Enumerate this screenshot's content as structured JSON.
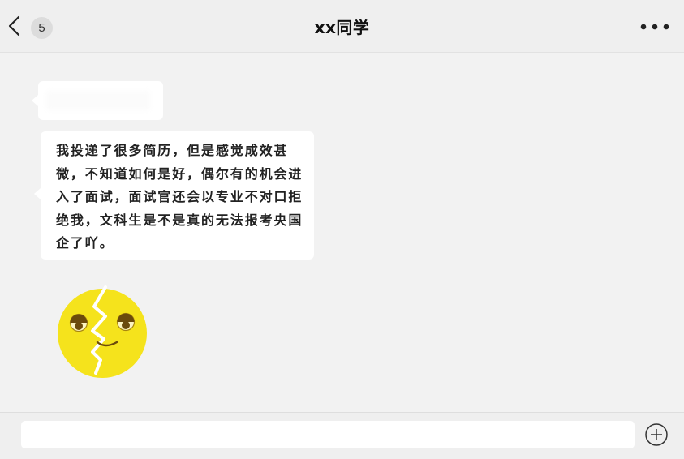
{
  "header": {
    "unread_count": "5",
    "title": "xx同学",
    "back_icon": "chevron-left-icon",
    "more_icon": "more-dots-icon"
  },
  "messages": [
    {
      "type": "text",
      "content": "我投递了很多简历，但是感觉成效甚微，不知道如何是好，偶尔有的机会进入了面试，面试官还会以专业不对口拒绝我，文科生是不是真的无法报考央国企了吖。"
    },
    {
      "type": "sticker",
      "sticker_name": "broken-face-sticker"
    }
  ],
  "input": {
    "value": "",
    "plus_icon": "plus-circle-icon"
  },
  "colors": {
    "background": "#f2f2f2",
    "bubble": "#ffffff",
    "sticker_yellow": "#f5e31c"
  }
}
